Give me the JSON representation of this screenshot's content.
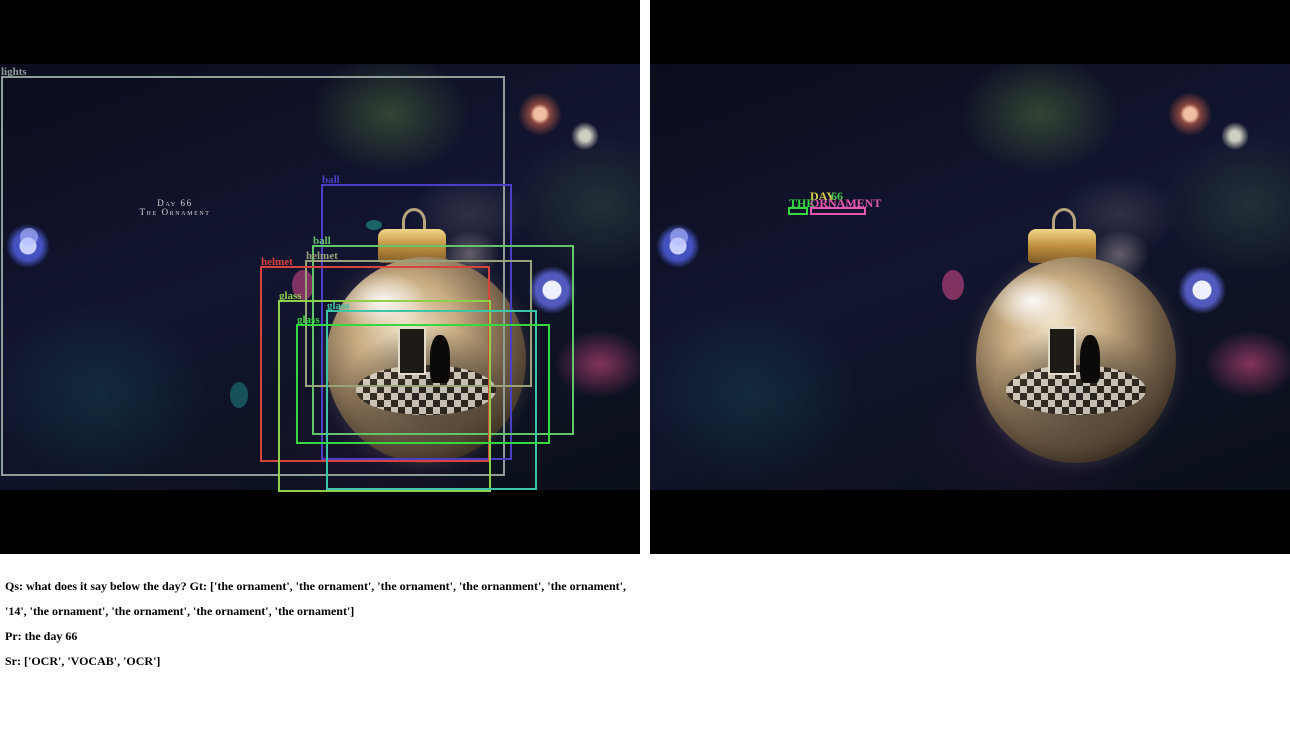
{
  "left_panel": {
    "image_text": {
      "line1": "Day 66",
      "line2": "The Ornament"
    },
    "detections": [
      {
        "label": "lights",
        "color": "#8e9e98"
      },
      {
        "label": "ball",
        "color": "#4b3fc8"
      },
      {
        "label": "ball",
        "color": "#63c46a"
      },
      {
        "label": "helmet",
        "color": "#9aa27a"
      },
      {
        "label": "helmet",
        "color": "#d8433e"
      },
      {
        "label": "glass",
        "color": "#8ed04a"
      },
      {
        "label": "glass",
        "color": "#3cc6a8"
      },
      {
        "label": "glass",
        "color": "#36d840"
      }
    ]
  },
  "right_panel": {
    "ocr_tokens": [
      {
        "label": "DAY",
        "color": "#d6d04a"
      },
      {
        "label": "66",
        "color": "#43c84a"
      },
      {
        "label": "THE",
        "color": "#36d840"
      },
      {
        "label": "ORNAMENT",
        "color": "#e458b0"
      }
    ]
  },
  "caption": {
    "question_line1": "Qs: what does it say below the day? Gt: ['the ornament', 'the ornament', 'the ornament', 'the ornanment', 'the ornament',",
    "question_line2": "'14', 'the ornament', 'the ornament', 'the ornament', 'the ornament']",
    "prediction": "Pr: the day 66",
    "sources": "Sr: ['OCR', 'VOCAB', 'OCR']"
  }
}
